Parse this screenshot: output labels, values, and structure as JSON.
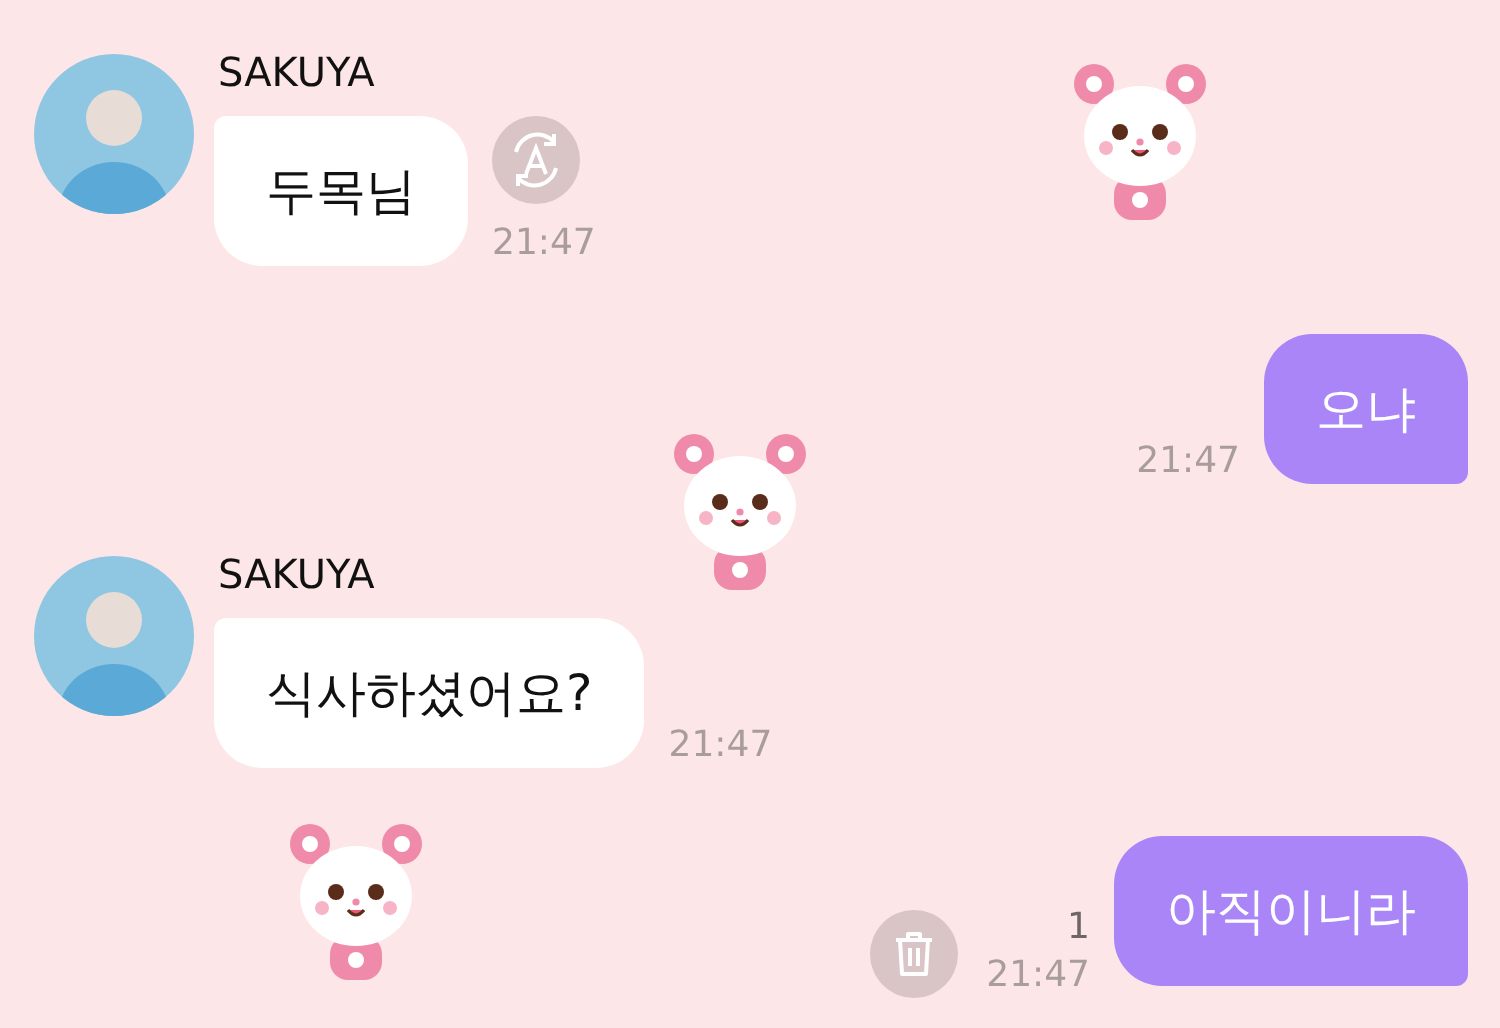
{
  "messages": [
    {
      "kind": "incoming",
      "sender": "SAKUYA",
      "text": "두목님",
      "time": "21:47",
      "action_button": {
        "kind": "translate"
      }
    },
    {
      "kind": "outgoing",
      "text": "오냐",
      "time": "21:47"
    },
    {
      "kind": "incoming",
      "sender": "SAKUYA",
      "text": "식사하셨어요?",
      "time": "21:47"
    },
    {
      "kind": "outgoing",
      "text": "아직이니라",
      "time": "21:47",
      "unread": "1",
      "action_button": {
        "kind": "delete"
      }
    }
  ]
}
